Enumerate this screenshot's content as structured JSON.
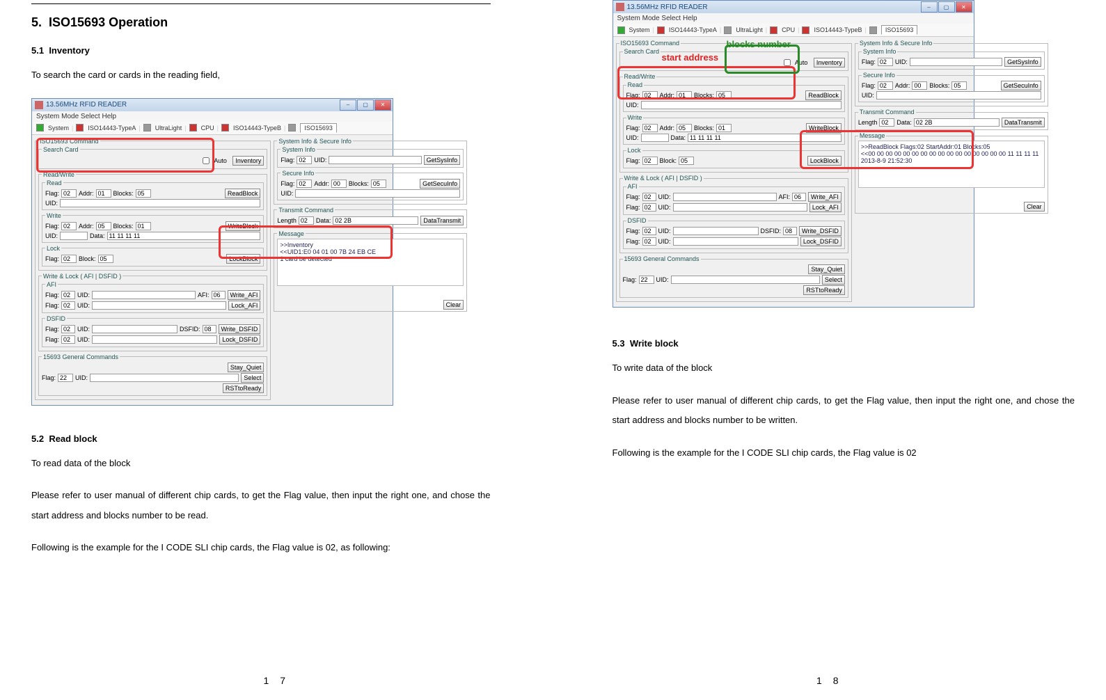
{
  "sec5": {
    "num": "5.",
    "title": "ISO15693 Operation"
  },
  "s51": {
    "num": "5.1",
    "title": "Inventory",
    "p1": "To search the card or cards in the reading field,"
  },
  "s52": {
    "num": "5.2",
    "title": "Read block",
    "p1": "To read data of the block",
    "p2": "Please refer to user manual of different chip cards, to get the Flag value, then input the right one, and chose the start address and blocks number to be read.",
    "p3": "Following is the example for the I CODE SLI chip cards, the Flag value is 02, as following:"
  },
  "s53": {
    "num": "5.3",
    "title": "Write block",
    "p1": "To write data of the block",
    "p2": "Please refer to user manual of different chip cards, to get the Flag value, then input the right one, and chose the start address and blocks number to be written.",
    "p3": "Following is the example for the I CODE SLI chip cards, the Flag value is 02"
  },
  "pg": {
    "l": "1 7",
    "r": "1 8"
  },
  "app": {
    "title": "13.56MHz RFID READER",
    "menu": "System   Mode Select   Help",
    "tabs": {
      "sys": "System",
      "a": "ISO14443-TypeA",
      "ul": "UltraLight",
      "cpu": "CPU",
      "b": "ISO14443-TypeB",
      "iso": "ISO15693"
    },
    "grp": {
      "iso": "ISO15693 Command",
      "search": "Search Card",
      "rw": "Read/Write",
      "read": "Read",
      "write": "Write",
      "lock": "Lock",
      "wl": "Write & Lock ( AFI | DSFID )",
      "afi": "AFI",
      "dsfid": "DSFID",
      "gc": "15693 General Commands",
      "sysinfo": "System Info & Secure Info",
      "si": "System Info",
      "sec": "Secure Info",
      "tx": "Transmit Command",
      "msg": "Message"
    },
    "lbl": {
      "flag": "Flag:",
      "addr": "Addr:",
      "blocks": "Blocks:",
      "uid": "UID:",
      "block": "Block:",
      "afi": "AFI:",
      "dsfid": "DSFID:",
      "length": "Length",
      "data": "Data:",
      "auto": "Auto"
    },
    "btn": {
      "inv": "Inventory",
      "rb": "ReadBlock",
      "wb": "WriteBlock",
      "lb": "LockBlock",
      "wafi": "Write_AFI",
      "lafi": "Lock_AFI",
      "wdsf": "Write_DSFID",
      "ldsf": "Lock_DSFID",
      "sq": "Stay_Quiet",
      "sel": "Select",
      "rst": "RSTtoReady",
      "gsi": "GetSysInfo",
      "gsu": "GetSecuInfo",
      "dt": "DataTransmit",
      "clr": "Clear"
    },
    "val": {
      "f02": "02",
      "a01": "01",
      "b05": "05",
      "a05": "05",
      "b01": "01",
      "a00": "00",
      "afi06": "06",
      "dsf08": "08",
      "f22": "22",
      "len": "02",
      "data": "02 2B",
      "wd": "11 11 11 11"
    },
    "msg1": {
      "l1": ">>Inventory",
      "l2": "<<UID1:E0 04 01 00 7B 24 EB CE",
      "l3": "1 card be detected"
    },
    "msg2": {
      "l1": ">>ReadBlock   Flags:02  StartAddr:01  Blocks:05",
      "l2": "<<00 00 00 00 00 00 00 00 00 00 00 00 00 00 00 00 11 11 11 11",
      "l3": "2013-8-9  21:52:30"
    }
  },
  "anno": {
    "sa": "start address",
    "bn": "blocks number"
  }
}
